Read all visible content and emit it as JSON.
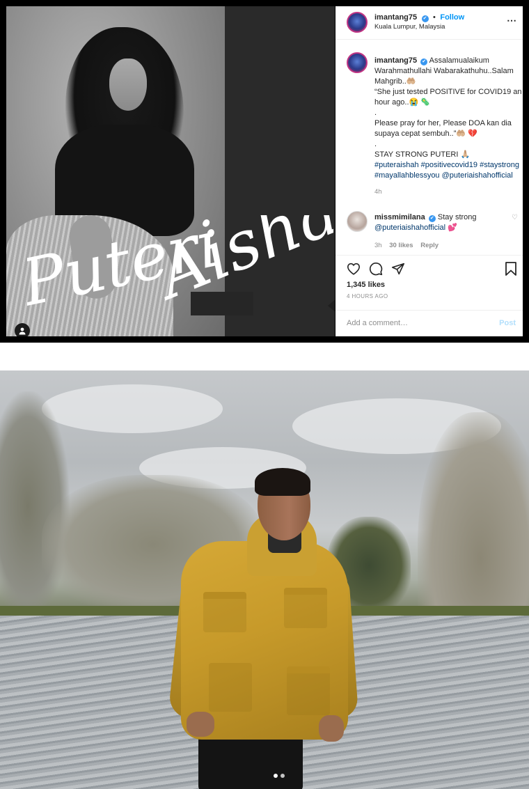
{
  "post": {
    "username": "imantang75",
    "verified_mark": "✔",
    "follow_separator": "•",
    "follow_label": "Follow",
    "location": "Kuala Lumpur, Malaysia",
    "more_icon": "⋯",
    "image_text": {
      "script_word_1": "Puteri",
      "script_word_2": "Aishah"
    },
    "caption": {
      "username": "imantang75",
      "lines": [
        "Assalamualaikum Warahmathullahi Wabarakathuhu..Salam Mahgrib..🤲🏼",
        "“She just tested POSITIVE for COVID19 an hour ago..😭 🦠",
        ".",
        "Please pray for her, Please DOA kan dia supaya cepat sembuh..”🤲🏼 💔",
        ".",
        "STAY STRONG PUTERI 🙏🏼"
      ],
      "hashtags": [
        "#puteraishah",
        "#positivecovid19",
        "#staystrong",
        "#mayallahblessyou",
        "@puteriaishahofficial"
      ],
      "time": "4h"
    },
    "comment": {
      "username": "missmimilana",
      "text": "Stay strong",
      "mention": "@puteriaishahofficial",
      "emoji": "💕",
      "time": "3h",
      "likes": "30 likes",
      "reply_label": "Reply"
    },
    "likes": "1,345 likes",
    "posted_ago": "4 HOURS AGO",
    "add_comment_placeholder": "Add a comment…",
    "post_button": "Post"
  },
  "carousel": {
    "active_index": 0,
    "total": 2,
    "colors": {
      "active": "#ffffff",
      "inactive": "#c4c4c4"
    }
  },
  "colors": {
    "link_blue": "#0095f6",
    "tag_navy": "#00376b",
    "muted": "#8e8e8e",
    "jacket_mustard": "#c99c2c"
  }
}
